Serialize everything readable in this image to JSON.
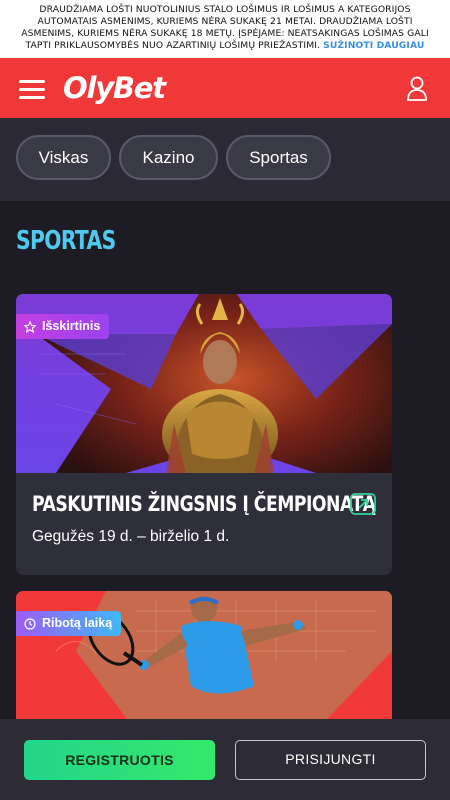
{
  "warning": {
    "text": "Draudžiama lošti nuotolinius stalo lošimus ir lošimus a kategorijos automatais asmenims, kuriems nėra sukakę 21 metai. Draudžiama lošti asmenims, kuriems nėra sukakę 18 metų. Įspėjame: neatsakingas lošimas gali tapti priklausomybės nuo azartinių lošimų priežastimi.",
    "link": "SUŽINOTI DAUGIAU"
  },
  "header": {
    "logo": "OlyBet",
    "bg_color": "#f13838"
  },
  "filters": {
    "chips": [
      {
        "label": "Viskas"
      },
      {
        "label": "Kazino"
      },
      {
        "label": "Sportas"
      }
    ]
  },
  "section": {
    "title": "SPORTAS",
    "title_color": "#4fc9f0"
  },
  "promos": [
    {
      "badge": "Išskirtinis",
      "title": "PASKUTINIS ŽINGSNIS Į ČEMPIONATĄ",
      "dates": "Gegužės 19 d. – birželio 1 d."
    },
    {
      "badge": "Ribotą laiką"
    }
  ],
  "bottom": {
    "register": "REGISTRUOTIS",
    "login": "PRISIJUNGTI",
    "register_color": "#2ed87a"
  },
  "icons": [
    "menu-icon",
    "user-icon",
    "star-icon",
    "external-link-icon",
    "clock-icon"
  ]
}
